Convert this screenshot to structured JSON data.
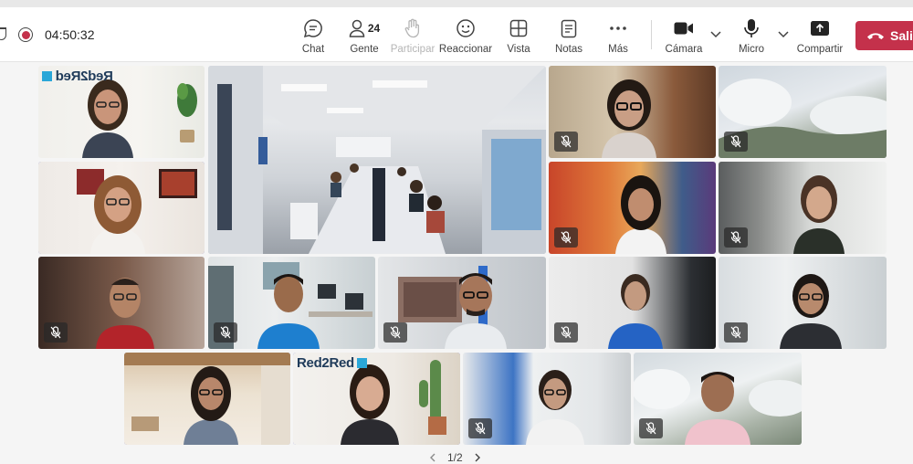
{
  "call": {
    "timer": "04:50:32",
    "people_count": "24",
    "pager": "1/2"
  },
  "toolbar": {
    "chat": "Chat",
    "people": "Gente",
    "raise": "Participar",
    "react": "Reaccionar",
    "view": "Vista",
    "notes": "Notas",
    "more": "Más",
    "camera": "Cámara",
    "mic": "Micro",
    "share": "Compartir",
    "leave": "Sali"
  },
  "brand": {
    "logo_a": "Red2Red",
    "logo_b": "Red2Red"
  },
  "icons": [
    "shield-icon",
    "record-icon",
    "chat-icon",
    "people-icon",
    "hand-icon",
    "emoji-icon",
    "grid-icon",
    "notes-icon",
    "more-icon",
    "camera-icon",
    "mic-icon",
    "share-icon",
    "phone-icon",
    "mic-off-icon"
  ],
  "colors": {
    "accent": "#5b5fc7",
    "leave": "#c4314b",
    "record": "#c4314b"
  }
}
